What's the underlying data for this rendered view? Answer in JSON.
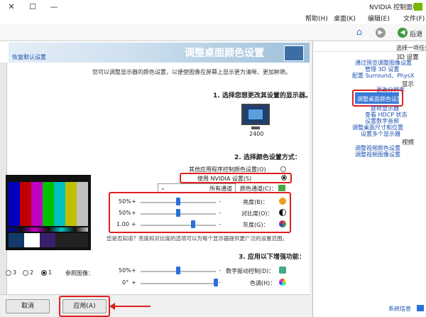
{
  "window": {
    "title": "NVIDIA 控制面板",
    "minimize_glyph": "—",
    "maximize_glyph": "☐",
    "close_glyph": "✕"
  },
  "menu": {
    "items": [
      "文件(F)",
      "编辑(E)",
      "桌面(K)",
      "帮助(H)"
    ]
  },
  "toolbar": {
    "back_label": "后退"
  },
  "page": {
    "title": "调整桌面颜色设置",
    "restore_label": "恢复默认设置",
    "description": "您可以调整显示器的颜色设置，以便使图像在屏幕上显示更为清晰、更加鲜艳。"
  },
  "section1": {
    "heading": "1. 选择您想更改其设置的显示器。",
    "display_name": "2400"
  },
  "section2": {
    "heading": "2. 选择颜色设置方式：",
    "option_other": "其他应用程序控制颜色设置(O)",
    "option_nvidia": "使用 NVIDIA 设置(S)",
    "channel_label": "颜色通道(C)：",
    "channel_value": "所有通道",
    "brightness_label": "亮度(B)：",
    "brightness_value": "50%",
    "brightness_fraction": 0.5,
    "contrast_label": "对比度(O)：",
    "contrast_value": "50%",
    "contrast_fraction": 0.5,
    "gamma_label": "灰度(G)：",
    "gamma_value": "1.00",
    "gamma_fraction": 0.3,
    "note": "您是否知道？亮度和对比度的选项可以为每个显示器提供更广泛的设置范围。"
  },
  "section3": {
    "heading": "3. 应用以下增强功能：",
    "vibrance_label": "数字振动控制(D)：",
    "vibrance_value": "50%",
    "vibrance_fraction": 0.5,
    "hue_label": "色调(H)：",
    "hue_value": "0°",
    "hue_fraction": 0.0
  },
  "reference": {
    "label": "参照图像：",
    "options": [
      "1",
      "2",
      "3"
    ]
  },
  "footer": {
    "apply_label": "应用(A)",
    "cancel_label": "取消",
    "sysinfo_label": "系统信息"
  },
  "sidebar": {
    "header": "选择一项任务...",
    "groups": [
      {
        "title": "3D 设置",
        "items": [
          "通过预览调整图像设置",
          "管理 3D 设置",
          "配置 Surround、PhysX"
        ]
      },
      {
        "title": "显示",
        "items": [
          "更改分辨率",
          "调整桌面颜色设置",
          "旋转显示器",
          "查看 HDCP 状态",
          "设置数字音频",
          "调整桌面尺寸和位置",
          "设置多个显示器"
        ]
      },
      {
        "title": "视频",
        "items": [
          "调整视频颜色设置",
          "调整视频图像设置"
        ]
      }
    ]
  },
  "colors": {
    "accent": "#2a6fdb",
    "highlight": "#e02020",
    "selected_item": "#3a7bd5"
  },
  "test_pattern": {
    "bars": [
      "#c0c0c0",
      "#c0c000",
      "#00c0c0",
      "#00c000",
      "#c000c0",
      "#c00000",
      "#0000c0"
    ]
  }
}
